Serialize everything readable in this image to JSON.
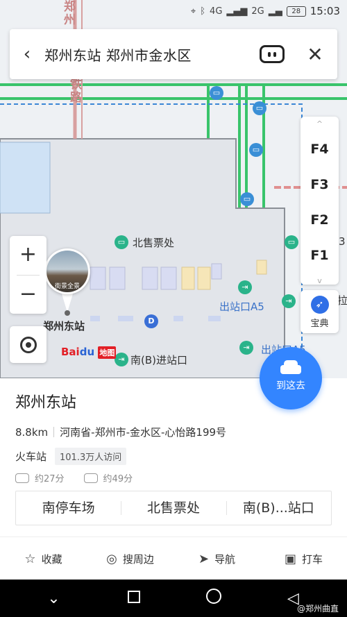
{
  "status_bar": {
    "icons": [
      "location-icon",
      "bluetooth-icon",
      "signal-4g-icon",
      "signal-2g-icon"
    ],
    "signal1": "4G",
    "signal2": "2G",
    "battery": "28",
    "time": "15:03"
  },
  "search": {
    "query": "郑州东站 郑州市金水区"
  },
  "map": {
    "road_label": "郑州铁路",
    "road_label_top": "郑州",
    "north_ticket": "北售票处",
    "station_label": "郑州东站",
    "streetview_caption": "街景全景",
    "exit_a5": "出站口A5",
    "exit_other": "出站口A5",
    "south_entrance": "南(B)进站口",
    "partial_label": "拉",
    "partial_num": "3",
    "baidu_text": "Bai",
    "baidu_paw": "du",
    "baidu_ditu": "地图"
  },
  "floors": {
    "up": "^",
    "items": [
      "F4",
      "F3",
      "F2",
      "F1"
    ],
    "down": "v"
  },
  "baodian": {
    "label": "宝典"
  },
  "zoom": {
    "in": "+",
    "out": "−"
  },
  "go_button": {
    "label": "到这去"
  },
  "place": {
    "name": "郑州东站",
    "distance": "8.8km",
    "address": "河南省-郑州市-金水区-心怡路199号",
    "category": "火车站",
    "visits": "101.3万人访问",
    "eta_car": "约27分",
    "eta_bus": "约49分"
  },
  "sub_pois": [
    "南停车场",
    "北售票处",
    "南(B)...站口"
  ],
  "actions": [
    {
      "icon": "star-icon",
      "glyph": "☆",
      "label": "收藏"
    },
    {
      "icon": "pin-icon",
      "glyph": "◎",
      "label": "搜周边"
    },
    {
      "icon": "navigate-icon",
      "glyph": "➤",
      "label": "导航"
    },
    {
      "icon": "taxi-icon",
      "glyph": "▣",
      "label": "打车"
    }
  ],
  "watermark": "@郑州曲直"
}
